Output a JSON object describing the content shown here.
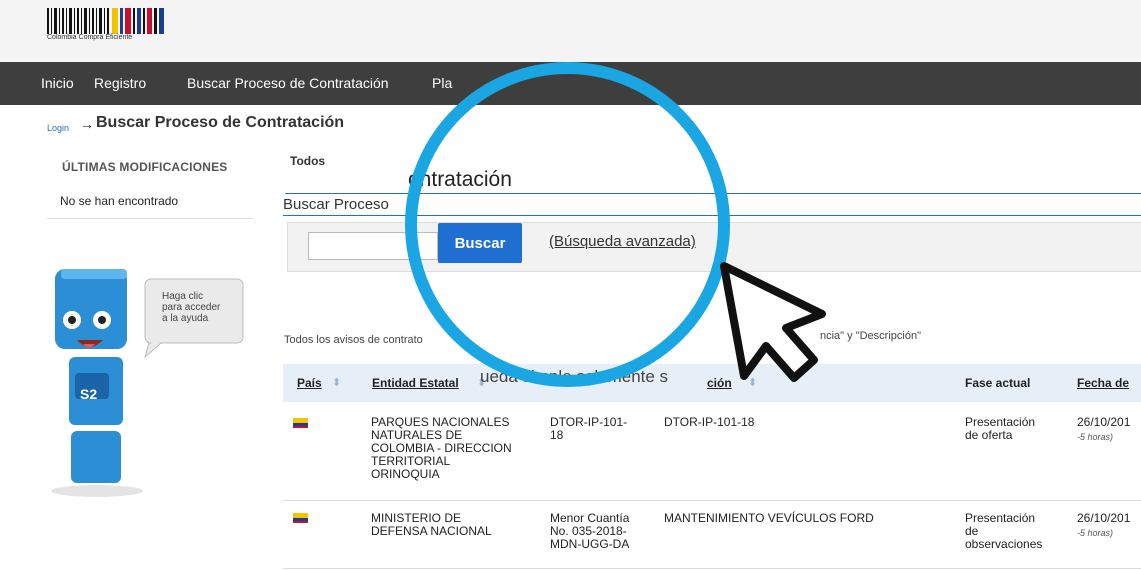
{
  "header": {
    "logo_text": "Colombia Compra Eficiente"
  },
  "nav": {
    "items": [
      "Inicio",
      "Registro",
      "Buscar Proceso de Contratación",
      "Pla"
    ]
  },
  "breadcrumb": {
    "login": "Login",
    "arrow": "→",
    "title": "Buscar Proceso de Contratación"
  },
  "sidebar": {
    "heading": "ÚLTIMAS MODIFICACIONES",
    "empty_text": "No se han encontrado",
    "help_bubble": [
      "Haga clic",
      "para acceder",
      "a la ayuda"
    ],
    "mascot_badge": "S2"
  },
  "main": {
    "tab": "Todos",
    "title": "ontratación",
    "subtitle": "Buscar Proceso",
    "search_button": "Buscar",
    "advanced_link": "(Búsqueda avanzada)",
    "notice_left": "Todos los avisos de contrato",
    "notice_right": "ncia\" y \"Descripción\"",
    "overlay_text": "ueda simple solamente s"
  },
  "table": {
    "headers": {
      "pais": "País",
      "entidad": "Entidad Estatal",
      "ref": "ción",
      "fase": "Fase actual",
      "fecha": "Fecha de"
    },
    "rows": [
      {
        "entidad": [
          "PARQUES NACIONALES",
          "NATURALES DE",
          "COLOMBIA - DIRECCION",
          "TERRITORIAL",
          "ORINOQUIA"
        ],
        "ref": [
          "DTOR-IP-101-",
          "18"
        ],
        "desc": "DTOR-IP-101-18",
        "fase": [
          "Presentación",
          "de oferta"
        ],
        "fecha": "26/10/201",
        "fecha_sub": "-5 horas)"
      },
      {
        "entidad": [
          "MINISTERIO DE",
          "DEFENSA NACIONAL"
        ],
        "ref": [
          "Menor Cuantía",
          "No. 035-2018-",
          "MDN-UGG-DA"
        ],
        "desc": "MANTENIMIENTO VEVÍCULOS FORD",
        "fase": [
          "Presentación",
          "de",
          "observaciones"
        ],
        "fecha": "26/10/201",
        "fecha_sub": "-5 horas)"
      }
    ]
  },
  "colors": {
    "nav_bg": "#3e3e3e",
    "accent": "#1f6fd3",
    "lens": "#1aa6e2",
    "header_row": "#e6eef8"
  }
}
